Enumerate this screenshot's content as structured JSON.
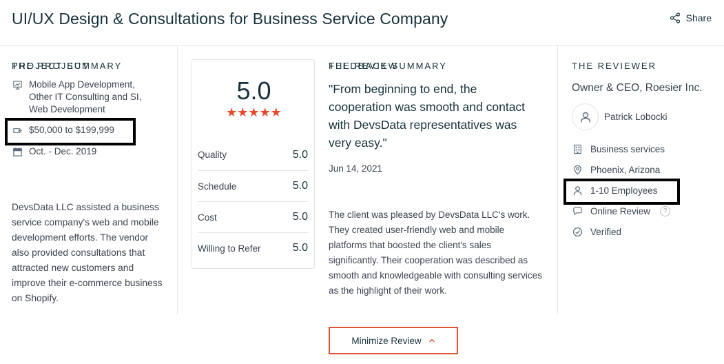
{
  "header": {
    "title": "UI/UX Design & Consultations for Business Service Company",
    "share_label": "Share"
  },
  "project": {
    "heading": "THE PROJECT",
    "services": "Mobile App Development, Other IT Consulting and SI, Web Development",
    "budget": "$50,000 to $199,999",
    "dates": "Oct. - Dec. 2019",
    "summary_heading": "PROJECT SUMMARY",
    "summary": "DevsData LLC assisted a business service company's web and mobile development efforts. The vendor also provided consultations that attracted new customers and improve their e-commerce business on Shopify."
  },
  "ratings": {
    "overall": "5.0",
    "stars": "★★★★★",
    "rows": [
      {
        "label": "Quality",
        "value": "5.0"
      },
      {
        "label": "Schedule",
        "value": "5.0"
      },
      {
        "label": "Cost",
        "value": "5.0"
      },
      {
        "label": "Willing to Refer",
        "value": "5.0"
      }
    ]
  },
  "review": {
    "heading": "THE REVIEW",
    "quote": "\"From beginning to end, the cooperation was smooth and contact with DevsData representatives was very easy.\"",
    "date": "Jun 14, 2021",
    "feedback_heading": "FEEDBACK SUMMARY",
    "feedback": "The client was pleased by DevsData LLC's work. They created user-friendly web and mobile platforms that boosted the client's sales significantly. Their cooperation was described as smooth and knowledgeable with consulting services as the highlight of their work."
  },
  "reviewer": {
    "heading": "THE REVIEWER",
    "title": "Owner & CEO, Roesier Inc.",
    "name": "Patrick Lobocki",
    "industry": "Business services",
    "location": "Phoenix, Arizona",
    "size": "1-10 Employees",
    "review_type": "Online Review",
    "help_glyph": "?",
    "verified": "Verified"
  },
  "actions": {
    "minimize_label": "Minimize Review",
    "minimize_icon": "chevron-up-icon"
  },
  "colors": {
    "accent": "#e0533a",
    "star": "#e8472a",
    "text_dark": "#17313b",
    "text": "#3b4351",
    "highlight": "#000000"
  }
}
